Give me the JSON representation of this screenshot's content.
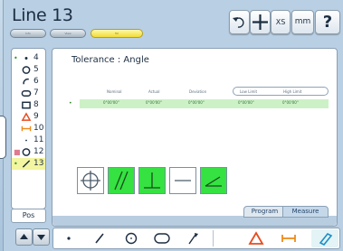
{
  "title": "Line 13",
  "mode_pills": [
    "Info",
    "View",
    "Tol"
  ],
  "toolbar": {
    "undo_icon": "undo-icon",
    "crosshair_icon": "crosshair-icon",
    "xs_label": "XS",
    "mm_label": "mm",
    "help_label": "?"
  },
  "features": [
    {
      "icon": "point-icon",
      "num": "4",
      "mark": "•",
      "mark_color": "#2a9a2a"
    },
    {
      "icon": "circle-icon",
      "num": "5",
      "mark": "",
      "mark_color": ""
    },
    {
      "icon": "arc-icon",
      "num": "6",
      "mark": "",
      "mark_color": ""
    },
    {
      "icon": "slot-icon",
      "num": "7",
      "mark": "",
      "mark_color": ""
    },
    {
      "icon": "rectangle-icon",
      "num": "8",
      "mark": "",
      "mark_color": ""
    },
    {
      "icon": "triangle-icon",
      "num": "9",
      "mark": "",
      "mark_color": ""
    },
    {
      "icon": "distance-icon",
      "num": "10",
      "mark": "",
      "mark_color": ""
    },
    {
      "icon": "dot-icon",
      "num": "11",
      "mark": "",
      "mark_color": ""
    },
    {
      "icon": "circle-icon",
      "num": "12",
      "mark": "■",
      "mark_color": "#e07a8f"
    },
    {
      "icon": "line-icon",
      "num": "13",
      "mark": "•",
      "mark_color": "#2a9a2a"
    }
  ],
  "selected_feature": "13",
  "pos_label": "Pos",
  "tolerance": {
    "title": "Tolerance : Angle",
    "headers": [
      "Nominal",
      "Actual",
      "Deviation",
      "Low Limit",
      "High Limit"
    ],
    "values": [
      "0°00'00\"",
      "0°00'00\"",
      "0°00'00\"",
      "0°00'00\"",
      "0°00'00\""
    ]
  },
  "tolerance_types": [
    "position-icon",
    "parallelism-icon",
    "perpendicularity-icon",
    "straightness-icon",
    "angularity-icon"
  ],
  "tabs": {
    "program": "Program",
    "measure": "Measure"
  },
  "bottom_tools": [
    "point-tool-icon",
    "line-tool-icon",
    "circle-tool-icon",
    "slot-tool-icon",
    "probe-tool-icon",
    "triangle-tool-icon",
    "distance-tool-icon",
    "skew-tool-icon"
  ],
  "colors": {
    "accent_green": "#35e241",
    "header_blue": "#1c2e42",
    "pill_active": "#f1dc38"
  }
}
